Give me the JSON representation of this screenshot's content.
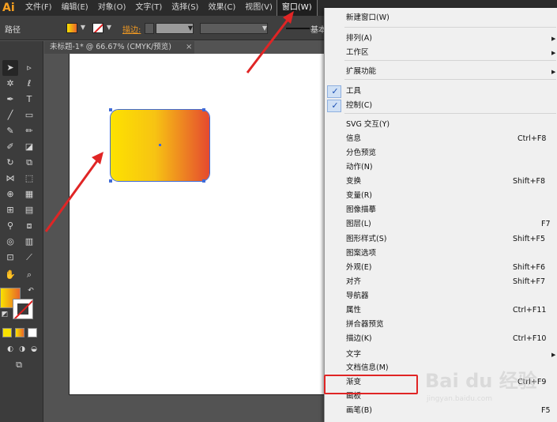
{
  "menubar": {
    "logo": "Ai",
    "items": [
      "文件(F)",
      "编辑(E)",
      "对象(O)",
      "文字(T)",
      "选择(S)",
      "效果(C)",
      "视图(V)",
      "窗口(W)"
    ]
  },
  "controlbar": {
    "path_label": "路径",
    "stroke_label": "描边:",
    "brush_label": "基本"
  },
  "document": {
    "tab_title": "未标题-1* @ 66.67% (CMYK/预览)",
    "tab_close": "×"
  },
  "window_menu": {
    "items": [
      {
        "label": "新建窗口(W)",
        "shortcut": "",
        "submenu": false,
        "checked": false
      },
      {
        "label": "排列(A)",
        "shortcut": "",
        "submenu": true,
        "checked": false
      },
      {
        "label": "工作区",
        "shortcut": "",
        "submenu": true,
        "checked": false
      },
      {
        "label": "扩展功能",
        "shortcut": "",
        "submenu": true,
        "checked": false
      },
      {
        "label": "工具",
        "shortcut": "",
        "submenu": false,
        "checked": true
      },
      {
        "label": "控制(C)",
        "shortcut": "",
        "submenu": false,
        "checked": true
      },
      {
        "label": "SVG 交互(Y)",
        "shortcut": "",
        "submenu": false,
        "checked": false
      },
      {
        "label": "信息",
        "shortcut": "Ctrl+F8",
        "submenu": false,
        "checked": false
      },
      {
        "label": "分色预览",
        "shortcut": "",
        "submenu": false,
        "checked": false
      },
      {
        "label": "动作(N)",
        "shortcut": "",
        "submenu": false,
        "checked": false
      },
      {
        "label": "变换",
        "shortcut": "Shift+F8",
        "submenu": false,
        "checked": false
      },
      {
        "label": "变量(R)",
        "shortcut": "",
        "submenu": false,
        "checked": false
      },
      {
        "label": "图像描摹",
        "shortcut": "",
        "submenu": false,
        "checked": false
      },
      {
        "label": "图层(L)",
        "shortcut": "F7",
        "submenu": false,
        "checked": false
      },
      {
        "label": "图形样式(S)",
        "shortcut": "Shift+F5",
        "submenu": false,
        "checked": false
      },
      {
        "label": "图案选项",
        "shortcut": "",
        "submenu": false,
        "checked": false
      },
      {
        "label": "外观(E)",
        "shortcut": "Shift+F6",
        "submenu": false,
        "checked": false
      },
      {
        "label": "对齐",
        "shortcut": "Shift+F7",
        "submenu": false,
        "checked": false
      },
      {
        "label": "导航器",
        "shortcut": "",
        "submenu": false,
        "checked": false
      },
      {
        "label": "属性",
        "shortcut": "Ctrl+F11",
        "submenu": false,
        "checked": false
      },
      {
        "label": "拼合器预览",
        "shortcut": "",
        "submenu": false,
        "checked": false
      },
      {
        "label": "描边(K)",
        "shortcut": "Ctrl+F10",
        "submenu": false,
        "checked": false
      },
      {
        "label": "文字",
        "shortcut": "",
        "submenu": true,
        "checked": false
      },
      {
        "label": "文档信息(M)",
        "shortcut": "",
        "submenu": false,
        "checked": false
      },
      {
        "label": "渐变",
        "shortcut": "Ctrl+F9",
        "submenu": false,
        "checked": false
      },
      {
        "label": "画板",
        "shortcut": "",
        "submenu": false,
        "checked": false
      },
      {
        "label": "画笔(B)",
        "shortcut": "F5",
        "submenu": false,
        "checked": false
      }
    ],
    "check_mark": "✓",
    "submenu_arrow": "▶"
  },
  "watermark": {
    "text": "Bai du 经验",
    "sub": "jingyan.baidu.com"
  },
  "colors": {
    "gradient_start": "#fde200",
    "gradient_end": "#e54a2f",
    "annotation_red": "#e02525",
    "selection_blue": "#3f6bd8"
  }
}
